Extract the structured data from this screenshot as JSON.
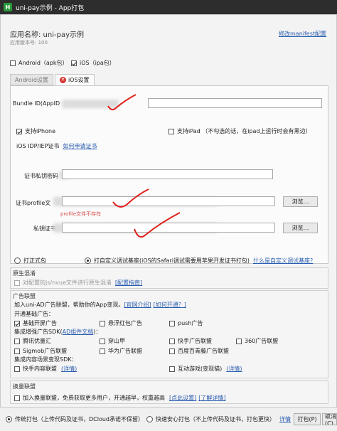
{
  "window": {
    "title": "uni-pay示例 - App打包",
    "app_icon": "H"
  },
  "app": {
    "name_label": "应用名称: uni-pay示例",
    "version_label": "应用版本号: 100",
    "modify_manifest": "修改manifest配置"
  },
  "platforms": {
    "android": "Android（apk包）",
    "ios": "iOS（ipa包）"
  },
  "tabs": {
    "android": "Android设置",
    "ios": "iOS设置"
  },
  "ios": {
    "bundle_label": "Bundle ID(AppID",
    "iphone_label": "支持iPhone",
    "ipad_label": "支持iPad （不勾选的话，在ipad上运行时会有黑边）",
    "idp_label": "iOS IDP/IEP证书",
    "how_to_apply": "如何申请证书",
    "cert_pwd_label": "证书私钥密码",
    "profile_label": "证书profile文",
    "profile_hint": "profile文件不存在",
    "privkey_label": "私钥证书",
    "browse_label": "浏览..."
  },
  "cert_type": {
    "formal": "打正式包",
    "custom": "打自定义调试基座(iOS的Safari调试需要用苹果开发证书打包)",
    "what_is": "什么是自定义调试基座?"
  },
  "obfuscation": {
    "title": "原生混淆",
    "check_label": "对配置的js/nvue文件进行原生混淆",
    "guide": "[配置指南]"
  },
  "ads": {
    "title": "广告联盟",
    "join_text": "加入uni-AD广告联盟，帮助你的App变现。",
    "official_intro": "[官网介绍]",
    "how_open": "[如何开通？]",
    "basic_title": "开通基础广告：",
    "basic": {
      "splash": "基础开屏广告",
      "float_redpack": "悬浮红包广告",
      "push": "push广告"
    },
    "enhanced_title": "集成增强广告SDK(",
    "enhanced_link": "AD组件文档",
    "enhanced_close": ")：",
    "enhanced": [
      "腾讯优量汇",
      "穿山甲",
      "快手广告联盟",
      "360广告联盟",
      "Sigmob广告联盟",
      "华为广告联盟",
      "百度百青藤广告联盟"
    ],
    "content_title": "集成内容场景变现SDK：",
    "kuaishou_content": "快手内容联盟",
    "details": "(详情)",
    "interactive_game": "互动游戏(变现猫)"
  },
  "swap": {
    "title": "换量联盟",
    "check_label": "加入换量联盟，免费获取更多用户，开通越早，权重越高",
    "set_now": "[点此设置]",
    "learn": "[了解详情]"
  },
  "bottom": {
    "traditional": "传统打包（上传代码及证书，DCloud承诺不保留）",
    "fast_safe": "快速安心打包（不上传代码及证书，打包更快）",
    "details": "详情",
    "pack_button": "打包(P)",
    "cancel_button": "取消(C)"
  },
  "colors": {
    "accent_link": "#2a5db0",
    "error": "#d9312b",
    "annotation": "#e0201c",
    "titlebar": "#2d2d2d"
  }
}
